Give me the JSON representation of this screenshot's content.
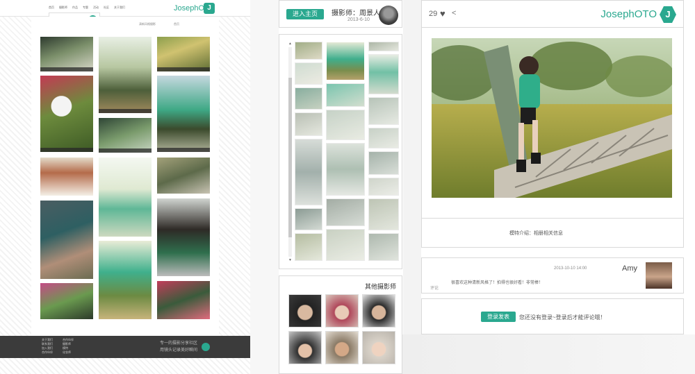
{
  "left_page": {
    "logo_text": "JosephOTO",
    "nav_items": [
      "首页",
      "摄影师",
      "作品",
      "专题",
      "活动",
      "社区",
      "关于我们"
    ],
    "crumbs": [
      "首页",
      "清新风格摄影"
    ],
    "footer_cols": [
      {
        "title": "关于我们",
        "items": [
          "联系我们",
          "加入我们",
          "合作伙伴",
          "帮助"
        ]
      },
      {
        "title": "合作伙伴",
        "items": [
          "摄影师",
          "模特",
          "化妆师",
          "造型师"
        ]
      }
    ],
    "slogan": [
      "专一的摄影分享社区",
      "用镜头记录美好瞬间"
    ]
  },
  "photographer": {
    "name": "摄影师：周景人",
    "date": "2013-6-10",
    "enter_label": "进入主页"
  },
  "others": {
    "title": "其他摄影师"
  },
  "viewer": {
    "logo_text": "JosephOTO",
    "likes": "29",
    "description": "模特介绍：相册相关信息"
  },
  "comment": {
    "user": "Amy",
    "time": "2013-10-10 14:00",
    "text": "很喜欢这种清新风格了！拍得也很好看！非常棒！",
    "reply": "评论"
  },
  "login": {
    "button": "登录发表",
    "text": "您还没有登录~登录后才能评论哦！"
  }
}
